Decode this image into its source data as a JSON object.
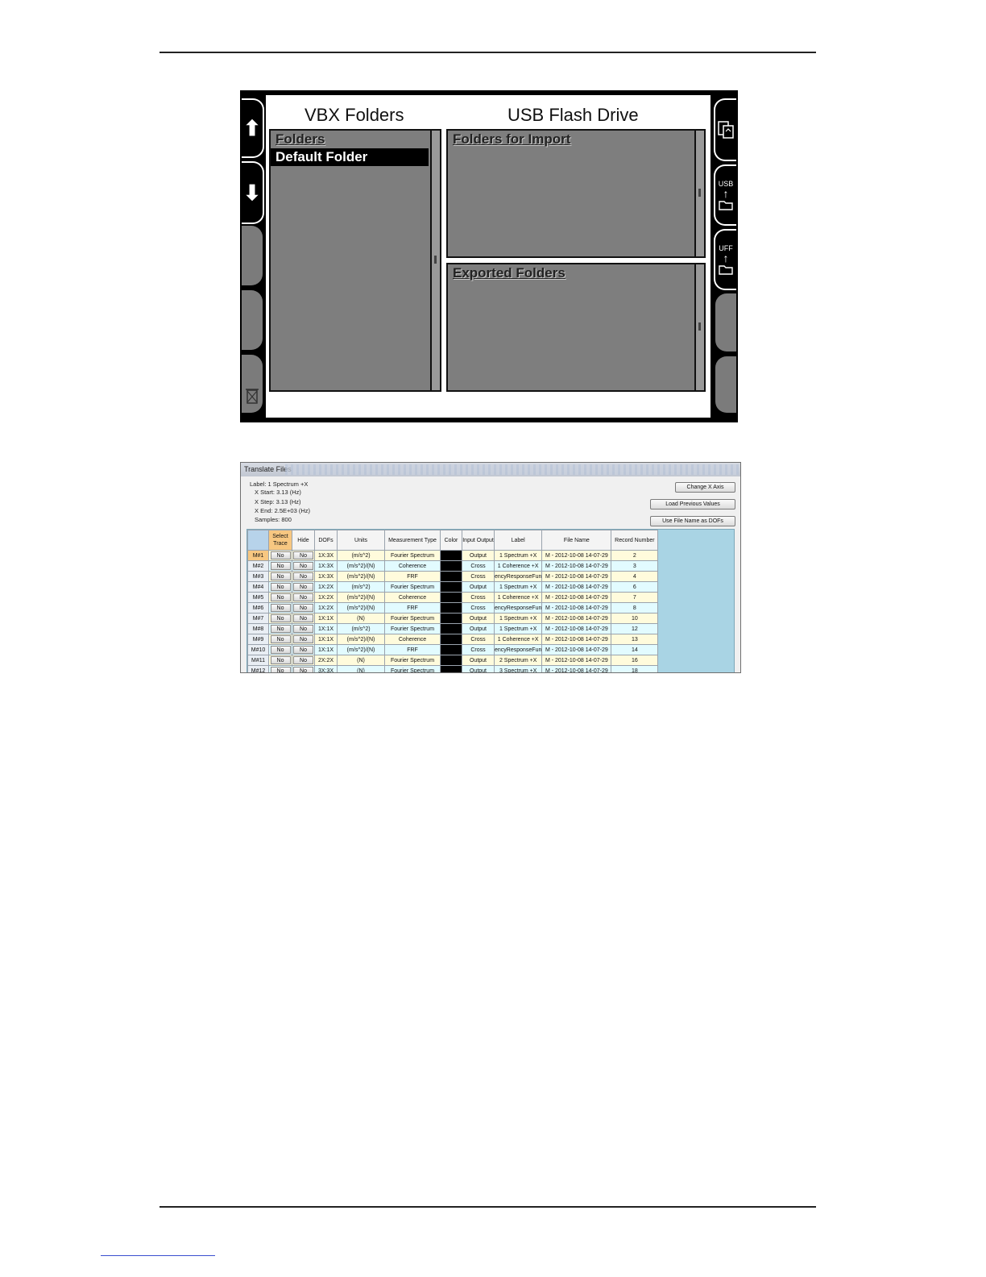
{
  "vbx": {
    "title_left": "VBX Folders",
    "title_right": "USB Flash Drive",
    "folders_header": "Folders",
    "selected_folder": "Default Folder",
    "import_header": "Folders for Import",
    "exported_header": "Exported Folders",
    "softkeys_left": [
      "up-arrow-icon",
      "down-arrow-icon",
      "",
      "",
      "trash-icon"
    ],
    "softkeys_right": [
      "copy-icon",
      "USB",
      "UFF",
      "",
      ""
    ],
    "usb_label": "USB",
    "uff_label": "UFF"
  },
  "translate": {
    "window_title": "Translate Files",
    "info": {
      "label": "Label: 1 Spectrum +X",
      "x_start": "X Start: 3.13 (Hz)",
      "x_step": "X Step: 3.13 (Hz)",
      "x_end": "X End: 2.5E+03 (Hz)",
      "samples": "Samples: 800"
    },
    "buttons": {
      "change_x_axis": "Change X Axis",
      "load_previous": "Load Previous Values",
      "use_file_name": "Use File Name as DOFs"
    },
    "columns": [
      "",
      "Select Trace",
      "Hide",
      "DOFs",
      "Units",
      "Measurement Type",
      "Color",
      "Input Output",
      "Label",
      "File Name",
      "Record Number"
    ],
    "rows": [
      {
        "id": "M#1",
        "select": "No",
        "hide": "No",
        "dofs": "1X:3X",
        "units": "(m/s^2)",
        "type": "Fourier Spectrum",
        "io": "Output",
        "label": "1 Spectrum +X",
        "file": "M - 2012-10-08 14-07-29",
        "record": "2"
      },
      {
        "id": "M#2",
        "select": "No",
        "hide": "No",
        "dofs": "1X:3X",
        "units": "(m/s^2)/(N)",
        "type": "Coherence",
        "io": "Cross",
        "label": "1 Coherence +X",
        "file": "M - 2012-10-08 14-07-29",
        "record": "3"
      },
      {
        "id": "M#3",
        "select": "No",
        "hide": "No",
        "dofs": "1X:3X",
        "units": "(m/s^2)/(N)",
        "type": "FRF",
        "io": "Cross",
        "label": "encyResponseFun",
        "file": "M - 2012-10-08 14-07-29",
        "record": "4"
      },
      {
        "id": "M#4",
        "select": "No",
        "hide": "No",
        "dofs": "1X:2X",
        "units": "(m/s^2)",
        "type": "Fourier Spectrum",
        "io": "Output",
        "label": "1 Spectrum +X",
        "file": "M - 2012-10-08 14-07-29",
        "record": "6"
      },
      {
        "id": "M#5",
        "select": "No",
        "hide": "No",
        "dofs": "1X:2X",
        "units": "(m/s^2)/(N)",
        "type": "Coherence",
        "io": "Cross",
        "label": "1 Coherence +X",
        "file": "M - 2012-10-08 14-07-29",
        "record": "7"
      },
      {
        "id": "M#6",
        "select": "No",
        "hide": "No",
        "dofs": "1X:2X",
        "units": "(m/s^2)/(N)",
        "type": "FRF",
        "io": "Cross",
        "label": "encyResponseFun",
        "file": "M - 2012-10-08 14-07-29",
        "record": "8"
      },
      {
        "id": "M#7",
        "select": "No",
        "hide": "No",
        "dofs": "1X:1X",
        "units": "(N)",
        "type": "Fourier Spectrum",
        "io": "Output",
        "label": "1 Spectrum +X",
        "file": "M - 2012-10-08 14-07-29",
        "record": "10"
      },
      {
        "id": "M#8",
        "select": "No",
        "hide": "No",
        "dofs": "1X:1X",
        "units": "(m/s^2)",
        "type": "Fourier Spectrum",
        "io": "Output",
        "label": "1 Spectrum +X",
        "file": "M - 2012-10-08 14-07-29",
        "record": "12"
      },
      {
        "id": "M#9",
        "select": "No",
        "hide": "No",
        "dofs": "1X:1X",
        "units": "(m/s^2)/(N)",
        "type": "Coherence",
        "io": "Cross",
        "label": "1 Coherence +X",
        "file": "M - 2012-10-08 14-07-29",
        "record": "13"
      },
      {
        "id": "M#10",
        "select": "No",
        "hide": "No",
        "dofs": "1X:1X",
        "units": "(m/s^2)/(N)",
        "type": "FRF",
        "io": "Cross",
        "label": "encyResponseFun",
        "file": "M - 2012-10-08 14-07-29",
        "record": "14"
      },
      {
        "id": "M#11",
        "select": "No",
        "hide": "No",
        "dofs": "2X:2X",
        "units": "(N)",
        "type": "Fourier Spectrum",
        "io": "Output",
        "label": "2 Spectrum +X",
        "file": "M - 2012-10-08 14-07-29",
        "record": "16"
      },
      {
        "id": "M#12",
        "select": "No",
        "hide": "No",
        "dofs": "3X:3X",
        "units": "(N)",
        "type": "Fourier Spectrum",
        "io": "Output",
        "label": "3 Spectrum +X",
        "file": "M - 2012-10-08 14-07-29",
        "record": "18"
      }
    ],
    "colors": {
      "row_odd": "#fffbdc",
      "row_even": "#e2fbff",
      "selected_header": "#f7c781",
      "trace_color": "#000000"
    }
  }
}
